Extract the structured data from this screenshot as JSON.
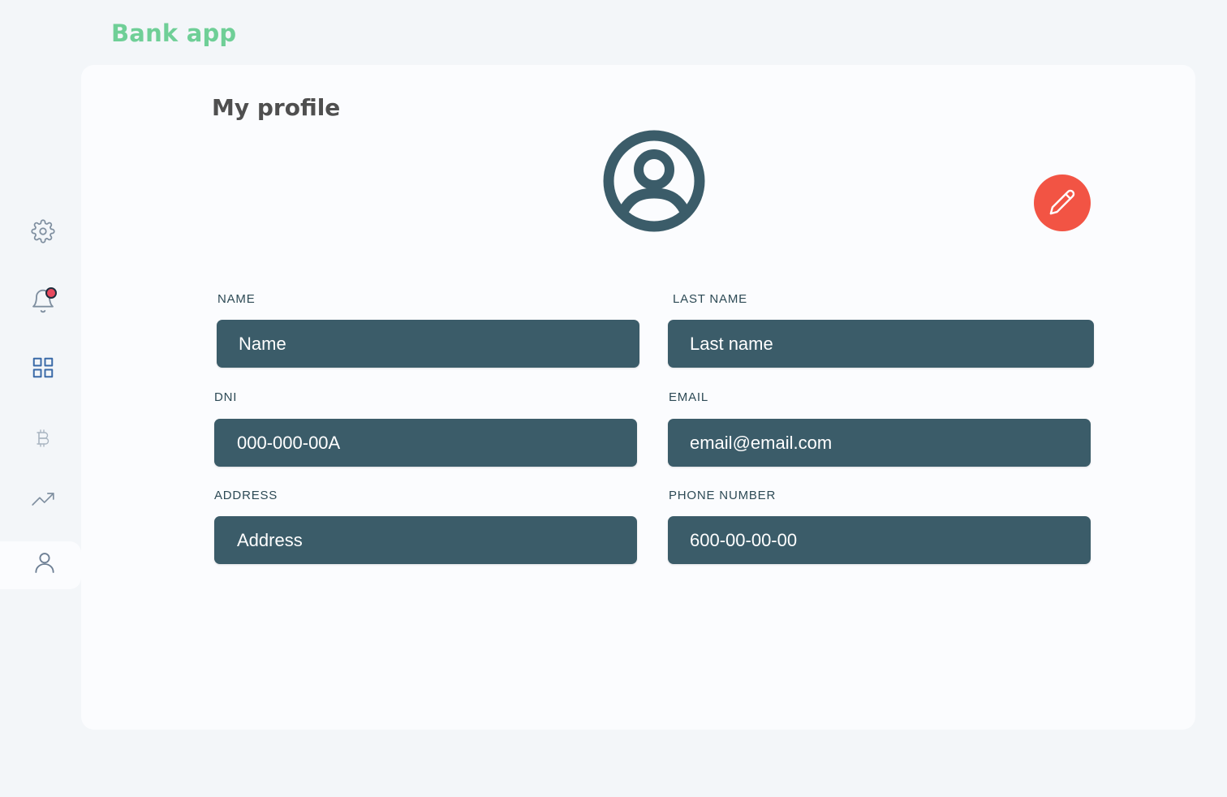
{
  "app": {
    "brand": "Bank app",
    "brand_color": "#6fcf97"
  },
  "sidebar": {
    "items": [
      {
        "icon": "gear-icon",
        "label": "Settings"
      },
      {
        "icon": "bell-icon",
        "label": "Notifications",
        "has_badge": true,
        "badge_color": "#e84a5f"
      },
      {
        "icon": "grid-icon",
        "label": "Dashboard"
      },
      {
        "icon": "bitcoin-icon",
        "label": "Crypto"
      },
      {
        "icon": "trending-up-icon",
        "label": "Investments"
      },
      {
        "icon": "user-icon",
        "label": "Profile",
        "active": true
      }
    ]
  },
  "main": {
    "title": "My profile",
    "avatar_icon": "user-circle-icon",
    "edit_button_icon": "pencil-icon",
    "edit_button_color": "#f25444"
  },
  "form": {
    "name": {
      "label": "NAME",
      "placeholder": "Name"
    },
    "last_name": {
      "label": "LAST NAME",
      "placeholder": "Last name"
    },
    "dni": {
      "label": "DNI",
      "placeholder": "000-000-00A"
    },
    "email": {
      "label": "EMAIL",
      "placeholder": "email@email.com"
    },
    "address": {
      "label": "ADDRESS",
      "placeholder": "Address"
    },
    "phone": {
      "label": "PHONE NUMBER",
      "placeholder": "600-00-00-00"
    }
  },
  "colors": {
    "input_bg": "#3b5c69",
    "label_text": "#2d4a55",
    "page_bg": "#f3f6f9",
    "card_bg": "#fbfcfe"
  }
}
